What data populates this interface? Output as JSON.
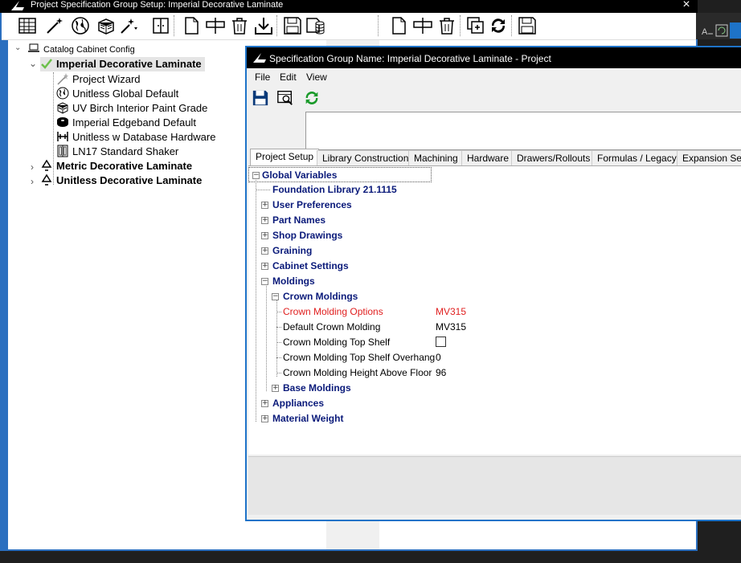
{
  "outer_window": {
    "title": "Project Specification Group Setup: Imperial Decorative Laminate",
    "close": "×"
  },
  "toolbar_icons": [
    "spreadsheet-icon",
    "magic-wand-icon",
    "globe-icon",
    "material-box-icon",
    "wand-dropdown-icon",
    "split-panel-icon",
    "new-page-icon",
    "insert-column-icon",
    "trash-icon",
    "download-icon",
    "save-icon",
    "database-save-icon",
    "new-page-icon",
    "insert-column-icon",
    "trash-icon",
    "copy-icon",
    "refresh-icon",
    "save-icon"
  ],
  "tree": {
    "root": "Catalog Cabinet Config",
    "spec_groups": [
      {
        "label": "Imperial Decorative Laminate",
        "expanded": true,
        "children": [
          {
            "label": "Project Wizard",
            "icon": "wizard-wand-icon"
          },
          {
            "label": "Unitless Global Default",
            "icon": "globe-icon"
          },
          {
            "label": "UV Birch Interior Paint Grade",
            "icon": "material-block-icon"
          },
          {
            "label": "Imperial Edgeband Default",
            "icon": "edgeband-roll-icon"
          },
          {
            "label": "Unitless w Database Hardware",
            "icon": "hardware-icon"
          },
          {
            "label": "LN17 Standard Shaker",
            "icon": "door-style-icon"
          }
        ]
      },
      {
        "label": "Metric Decorative Laminate",
        "expanded": false
      },
      {
        "label": "Unitless Decorative Laminate",
        "expanded": false
      }
    ]
  },
  "dialog": {
    "title": "Specification Group Name: Imperial Decorative Laminate - Project",
    "menu": [
      {
        "label": "File"
      },
      {
        "label": "Edit"
      },
      {
        "label": "View"
      }
    ],
    "tabs": [
      "Project Setup",
      "Library Construction",
      "Machining",
      "Hardware",
      "Drawers/Rollouts",
      "Formulas / Legacy",
      "Expansion Setti"
    ],
    "active_tab": "Project Setup",
    "grid": {
      "root": "Global Variables",
      "foundation": "Foundation Library 21.1115",
      "groups": [
        "User Preferences",
        "Part Names",
        "Shop Drawings",
        "Graining",
        "Cabinet Settings"
      ],
      "moldings": "Moldings",
      "crown": "Crown Moldings",
      "crown_rows": [
        {
          "label": "Crown Molding Options",
          "value": "MV315"
        },
        {
          "label": "Default Crown Molding",
          "value": "MV315"
        },
        {
          "label": "Crown Molding Top Shelf",
          "value": ""
        },
        {
          "label": "Crown Molding Top Shelf Overhang",
          "value": "0"
        },
        {
          "label": "Crown Molding Height Above Floor",
          "value": "96"
        }
      ],
      "base": "Base Moldings",
      "after_groups": [
        "Appliances",
        "Material Weight"
      ]
    }
  },
  "colors": {
    "accent": "#1e73c8",
    "group_text": "#0a1a7a",
    "highlight_text": "#e02020"
  }
}
